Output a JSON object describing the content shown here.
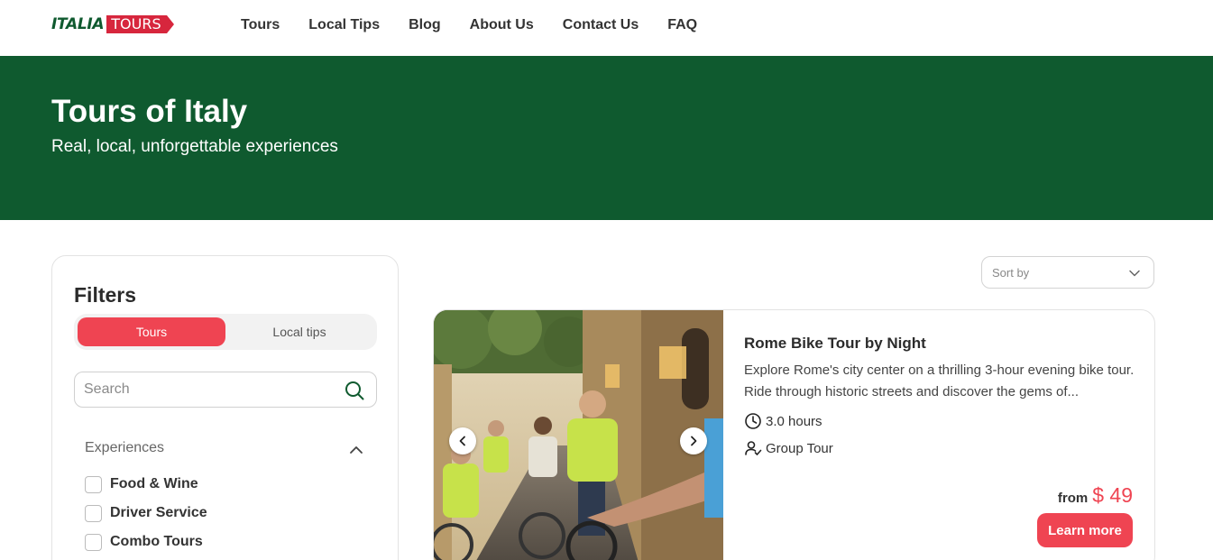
{
  "header": {
    "logo_left": "ITALIA",
    "logo_right": "TOURS",
    "nav": [
      "Tours",
      "Local Tips",
      "Blog",
      "About Us",
      "Contact Us",
      "FAQ"
    ]
  },
  "hero": {
    "title": "Tours of Italy",
    "subtitle": "Real, local, unforgettable experiences"
  },
  "filters": {
    "title": "Filters",
    "toggle": {
      "active": "Tours",
      "inactive": "Local tips"
    },
    "search_placeholder": "Search",
    "experiences_label": "Experiences",
    "options": [
      "Food & Wine",
      "Driver Service",
      "Combo Tours"
    ]
  },
  "sort": {
    "placeholder": "Sort by"
  },
  "tour": {
    "title": "Rome Bike Tour by Night",
    "description": "Explore Rome's city center on a thrilling 3-hour evening bike tour. Ride through historic streets and discover the gems of...",
    "duration": "3.0 hours",
    "type": "Group Tour",
    "price_prefix": "from",
    "price": "$ 49",
    "cta": "Learn more"
  },
  "colors": {
    "brand_green": "#0f5a2f",
    "brand_red": "#ef4452"
  },
  "icons": [
    "search-icon",
    "chevron-up-icon",
    "chevron-down-icon",
    "clock-icon",
    "user-icon",
    "chevron-left-icon",
    "chevron-right-icon"
  ]
}
